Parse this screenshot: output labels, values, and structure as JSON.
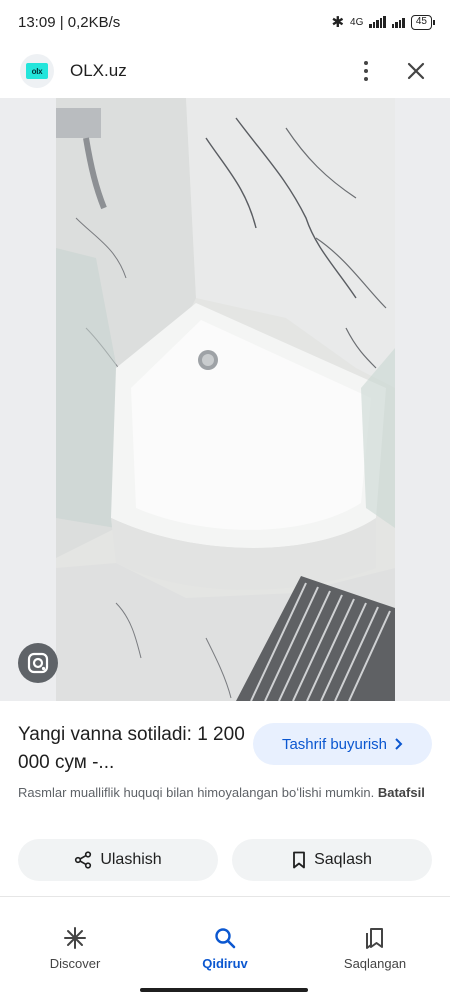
{
  "status_bar": {
    "time_speed": "13:09 | 0,2KB/s",
    "network": "4G",
    "battery": "45"
  },
  "header": {
    "site_name": "OLX.uz",
    "logo_text": "olx",
    "menu_icon": "more-vert-icon",
    "close_icon": "close-icon"
  },
  "result": {
    "title": "Yangi vanna sotiladi: 1 200 000 сум -...",
    "visit_label": "Tashrif buyurish",
    "notice_text": "Rasmlar mualliflik huquqi bilan himoyalangan boʻlishi mumkin.",
    "notice_link": "Batafsil",
    "share_label": "Ulashish",
    "save_label": "Saqlash"
  },
  "bottom_nav": {
    "items": [
      {
        "label": "Discover",
        "icon": "discover-icon"
      },
      {
        "label": "Qidiruv",
        "icon": "search-icon"
      },
      {
        "label": "Saqlangan",
        "icon": "saved-icon"
      }
    ]
  },
  "colors": {
    "accent": "#0b57d0",
    "visit_bg": "#e8f0fe",
    "olx_brand": "#23e5db"
  }
}
